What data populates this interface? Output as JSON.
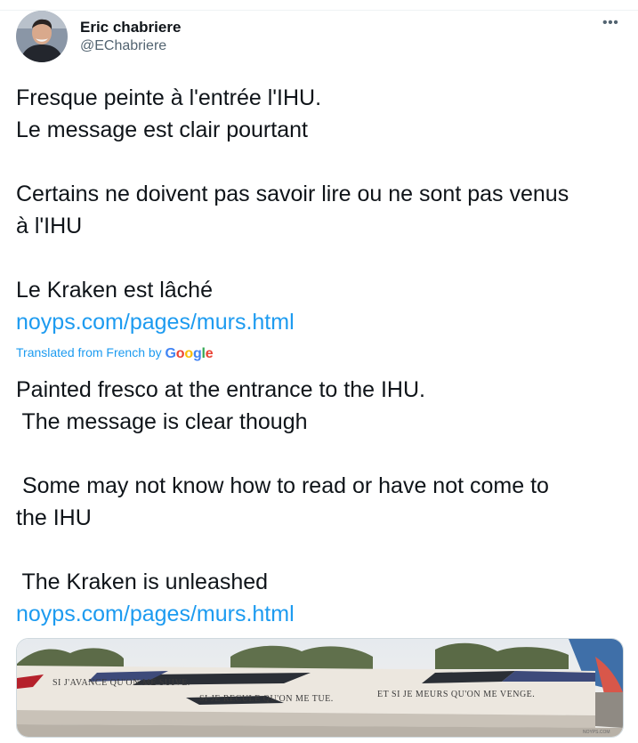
{
  "tweet": {
    "author_name": "Eric chabriere",
    "handle": "@EChabriere",
    "more_icon": "more-horizontal-icon",
    "original": {
      "line1": "Fresque peinte à l'entrée l'IHU.",
      "line2": "Le message est clair pourtant",
      "line3": "Certains ne doivent pas savoir lire ou ne sont pas venus",
      "line4": "à l'IHU",
      "line5": "Le Kraken est lâché",
      "link": "noyps.com/pages/murs.html"
    },
    "translation_label": "Translated from French by",
    "translation_provider": {
      "g1": "G",
      "o1": "o",
      "o2": "o",
      "g2": "g",
      "l": "l",
      "e": "e"
    },
    "translated": {
      "line1": "Painted fresco at the entrance to the IHU.",
      "line2": " The message is clear though",
      "line3": " Some may not know how to read or have not come to",
      "line4": "the IHU",
      "line5": " The Kraken is unleashed",
      "link": "noyps.com/pages/murs.html"
    },
    "media": {
      "fresco_text_1": "SI J'AVANCE QU'ON ME SUIVE.",
      "fresco_text_2": "SI JE RECULE QU'ON ME TUE.",
      "fresco_text_3": "ET SI JE MEURS QU'ON ME VENGE.",
      "watermark": "NOYPS.COM"
    }
  }
}
